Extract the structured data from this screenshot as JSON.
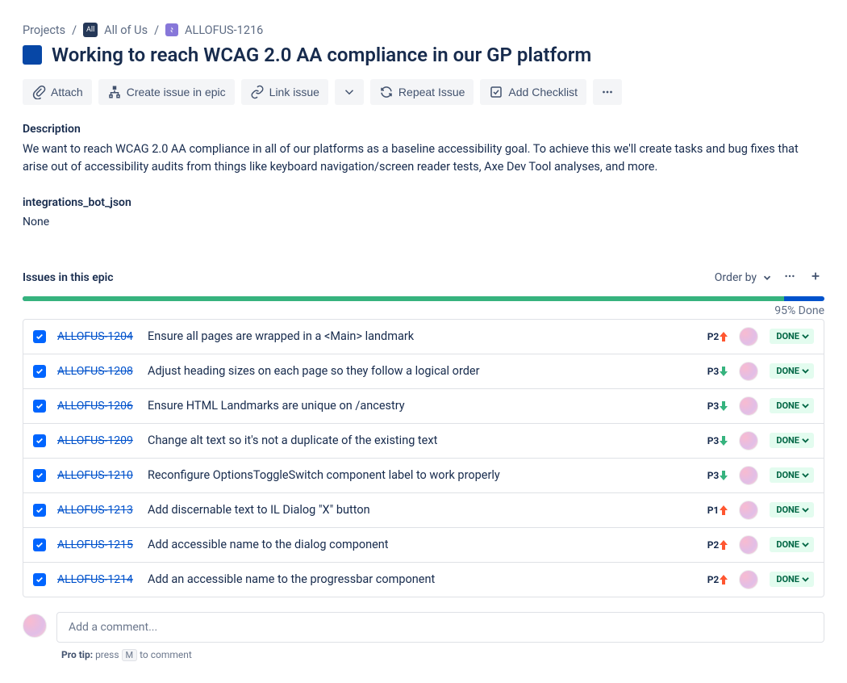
{
  "breadcrumb": {
    "root": "Projects",
    "project": "All of Us",
    "issue_key": "ALLOFUS-1216"
  },
  "title": "Working to reach WCAG 2.0 AA compliance in our GP platform",
  "toolbar": {
    "attach": "Attach",
    "create_issue": "Create issue in epic",
    "link_issue": "Link issue",
    "repeat_issue": "Repeat Issue",
    "add_checklist": "Add Checklist"
  },
  "description": {
    "label": "Description",
    "text": "We want to reach WCAG 2.0 AA compliance in all of our platforms as a baseline accessibility goal. To achieve this we'll create tasks and bug fixes that arise out of accessibility audits from things like keyboard navigation/screen reader tests, Axe Dev Tool analyses, and more."
  },
  "custom_field": {
    "label": "integrations_bot_json",
    "value": "None"
  },
  "epic_issues": {
    "title": "Issues in this epic",
    "order_by": "Order by",
    "done_percent": 95,
    "done_label": "95% Done",
    "status_label": "DONE",
    "items": [
      {
        "key": "ALLOFUS-1204",
        "summary": "Ensure all pages are wrapped in a <Main> landmark",
        "priority": "P2",
        "dir": "up"
      },
      {
        "key": "ALLOFUS-1208",
        "summary": "Adjust heading sizes on each page so they follow a logical order",
        "priority": "P3",
        "dir": "down"
      },
      {
        "key": "ALLOFUS-1206",
        "summary": "Ensure HTML Landmarks are unique on /ancestry",
        "priority": "P3",
        "dir": "down"
      },
      {
        "key": "ALLOFUS-1209",
        "summary": "Change alt text so it's not a duplicate of the existing text",
        "priority": "P3",
        "dir": "down"
      },
      {
        "key": "ALLOFUS-1210",
        "summary": "Reconfigure OptionsToggleSwitch component label to work properly",
        "priority": "P3",
        "dir": "down"
      },
      {
        "key": "ALLOFUS-1213",
        "summary": "Add discernable text to IL Dialog \"X\" button",
        "priority": "P1",
        "dir": "up"
      },
      {
        "key": "ALLOFUS-1215",
        "summary": "Add accessible name to the dialog component",
        "priority": "P2",
        "dir": "up"
      },
      {
        "key": "ALLOFUS-1214",
        "summary": "Add an accessible name to the progressbar component",
        "priority": "P2",
        "dir": "up"
      }
    ]
  },
  "comment": {
    "placeholder": "Add a comment...",
    "tip_prefix": "Pro tip:",
    "tip_press": "press",
    "tip_key": "M",
    "tip_suffix": "to comment"
  }
}
